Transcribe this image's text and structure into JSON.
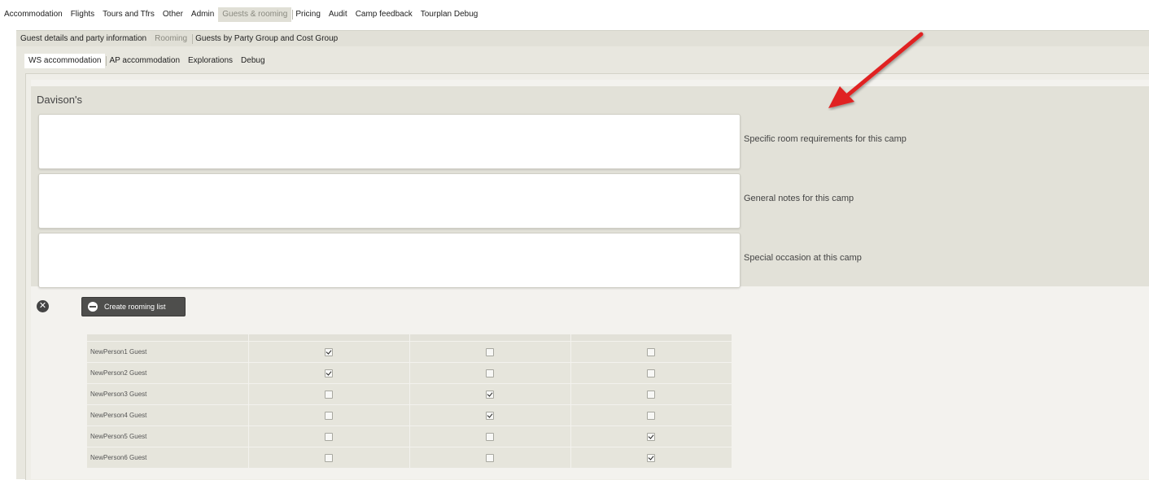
{
  "tabs_level1": [
    {
      "label": "Accommodation",
      "active": false
    },
    {
      "label": "Flights",
      "active": false
    },
    {
      "label": "Tours and Tfrs",
      "active": false
    },
    {
      "label": "Other",
      "active": false
    },
    {
      "label": "Admin",
      "active": false
    },
    {
      "label": "Guests & rooming",
      "active": true
    },
    {
      "label": "Pricing",
      "active": false
    },
    {
      "label": "Audit",
      "active": false
    },
    {
      "label": "Camp feedback",
      "active": false
    },
    {
      "label": "Tourplan Debug",
      "active": false
    }
  ],
  "tabs_level2": [
    {
      "label": "Guest details and party information",
      "active": false
    },
    {
      "label": "Rooming",
      "active": true
    },
    {
      "label": "Guests by Party Group and Cost Group",
      "active": false
    }
  ],
  "tabs_level3": [
    {
      "label": "WS accommodation",
      "active": true
    },
    {
      "label": "AP accommodation",
      "active": false
    },
    {
      "label": "Explorations",
      "active": false
    },
    {
      "label": "Debug",
      "active": false
    }
  ],
  "camp": {
    "name": "Davison's",
    "notes": [
      {
        "label": "Specific room requirements for this camp",
        "value": ""
      },
      {
        "label": "General notes for this camp",
        "value": ""
      },
      {
        "label": "Special occasion at this camp",
        "value": ""
      }
    ]
  },
  "actions": {
    "create_rooming_label": "Create rooming list",
    "remove_icon": "close-circle-icon",
    "create_icon": "minus-circle-icon"
  },
  "rooming_table": {
    "rows": [
      {
        "name": "NewPerson1 Guest",
        "checks": [
          true,
          false,
          false
        ]
      },
      {
        "name": "NewPerson2 Guest",
        "checks": [
          true,
          false,
          false
        ]
      },
      {
        "name": "NewPerson3 Guest",
        "checks": [
          false,
          true,
          false
        ]
      },
      {
        "name": "NewPerson4 Guest",
        "checks": [
          false,
          true,
          false
        ]
      },
      {
        "name": "NewPerson5 Guest",
        "checks": [
          false,
          false,
          true
        ]
      },
      {
        "name": "NewPerson6 Guest",
        "checks": [
          false,
          false,
          true
        ]
      }
    ]
  },
  "annotation": {
    "icon": "red-arrow-icon",
    "color": "#e02020"
  },
  "colors": {
    "tab_strip": "#e1e0d7",
    "panel": "#e2e1d8",
    "button": "#4e4e4c"
  }
}
